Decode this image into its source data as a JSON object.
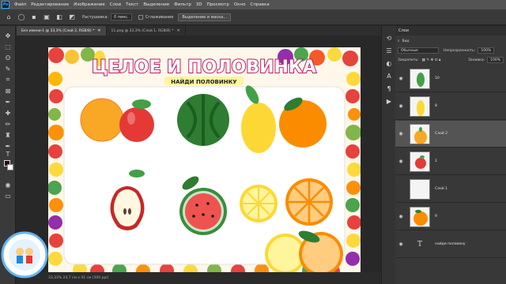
{
  "app": {
    "logo_text": "Ps",
    "menu": [
      "Файл",
      "Редактирование",
      "Изображение",
      "Слои",
      "Текст",
      "Выделение",
      "Фильтр",
      "3D",
      "Просмотр",
      "Окно",
      "Справка"
    ]
  },
  "options": {
    "tolerance_label": "Растушевка:",
    "tolerance_value": "0 пикс.",
    "smoothing_label": "Сглаживание",
    "select_mask_button": "Выделение и маска..."
  },
  "tabs": [
    {
      "label": "Без имени-1 @ 33,3% (Слой 2, RGB/8) *",
      "active": true
    },
    {
      "label": "11.png @ 33,3% (Слой 1, RGB/8) *",
      "active": false
    }
  ],
  "artwork": {
    "title": "ЦЕЛОЕ И ПОЛОВИНКА",
    "subtitle": "НАЙДИ ПОЛОВИНКУ"
  },
  "status": {
    "text": "33,33%      24,7 см x 41 см (300 ppi)"
  },
  "layers_panel": {
    "tab_label": "Слои",
    "filter_label": "Вид",
    "blend_mode": "Обычные",
    "opacity_label": "Непрозрачность:",
    "opacity_value": "100%",
    "lock_label": "Закрепить:",
    "fill_label": "Заливка:",
    "fill_value": "100%",
    "layers": [
      {
        "name": "10",
        "selected": false,
        "thumb": "leaf"
      },
      {
        "name": "8",
        "selected": false,
        "thumb": "lemon"
      },
      {
        "name": "Слой 2",
        "selected": true,
        "thumb": "pear"
      },
      {
        "name": "2",
        "selected": false,
        "thumb": "apple"
      },
      {
        "name": "Слой 1",
        "selected": false,
        "thumb": "blank"
      },
      {
        "name": "9",
        "selected": false,
        "thumb": "orange"
      },
      {
        "name": "найди половину",
        "selected": false,
        "thumb": "text"
      }
    ]
  },
  "colors": {
    "accent": "#31a8ff",
    "foreground": "#2a0a0a",
    "background": "#ffffff"
  }
}
